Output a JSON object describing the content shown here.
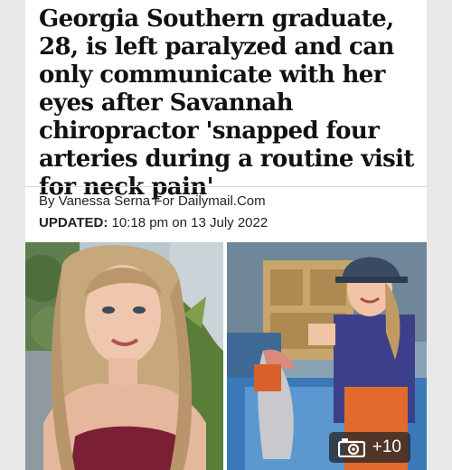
{
  "article": {
    "headline": "Georgia Southern graduate, 28, is left paralyzed and can only communicate with her eyes after Savannah chiropractor 'snapped four arteries during a routine visit for neck pain'",
    "byline": "By Vanessa Serna For Dailymail.Com",
    "updated_label": "UPDATED:",
    "updated_value": " 10:18 pm on 13 July 2022"
  },
  "gallery": {
    "count_label": "+10",
    "icon": "camera-icon"
  },
  "colors": {
    "headline": "#111111",
    "background": "#e9e9e9",
    "badge": "#282828"
  }
}
